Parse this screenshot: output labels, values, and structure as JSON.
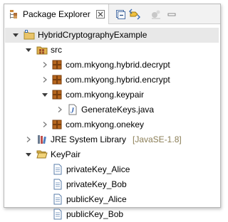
{
  "view": {
    "tab_title": "Package Explorer",
    "tab_close_label": "☒"
  },
  "toolbar": {
    "buttons": [
      "collapse-all",
      "link-with-editor",
      "view-menu-disabled",
      "minimize"
    ]
  },
  "tree": {
    "project": "HybridCryptographyExample",
    "src": "src",
    "pkg_decrypt": "com.mkyong.hybrid.decrypt",
    "pkg_encrypt": "com.mkyong.hybrid.encrypt",
    "pkg_keypair": "com.mkyong.keypair",
    "file_generatekeys": "GenerateKeys.java",
    "pkg_onekey": "com.mkyong.onekey",
    "jre_label": "JRE System Library",
    "jre_decoration": "[JavaSE-1.8]",
    "folder_keypair": "KeyPair",
    "file_privA": "privateKey_Alice",
    "file_privB": "privateKey_Bob",
    "file_pubA": "publicKey_Alice",
    "file_pubB": "publicKey_Bob"
  },
  "colors": {
    "package": "#a0522d",
    "folder": "#e8c46a",
    "source_folder": "#d8a84a",
    "java_file_letter": "#2a5db0",
    "jre": "#6b7a8f",
    "decoration": "#8a7d55",
    "selection": "#e8e8e8"
  }
}
